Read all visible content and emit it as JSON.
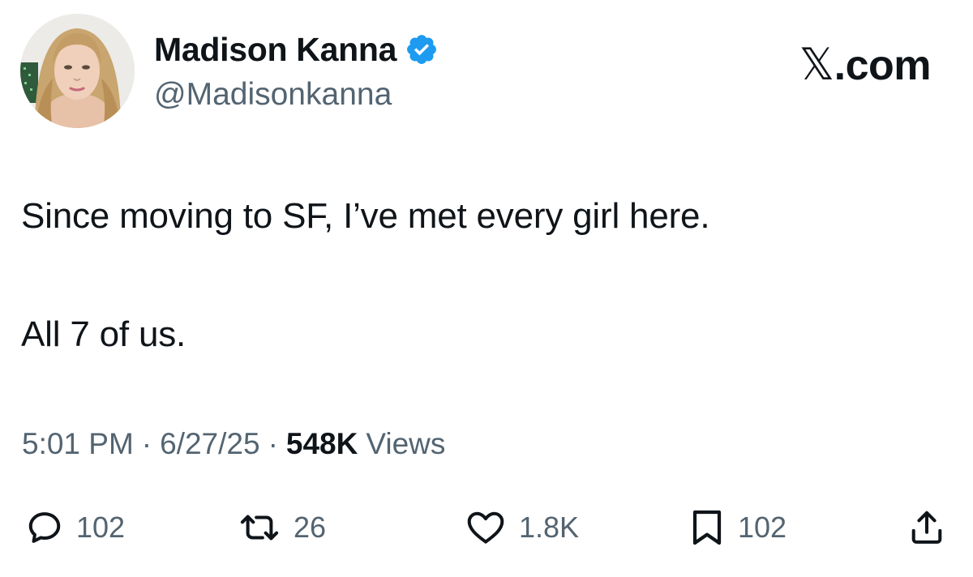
{
  "author": {
    "display_name": "Madison Kanna",
    "handle": "@Madisonkanna",
    "verified": true,
    "verified_color": "#1d9bf0"
  },
  "brand": {
    "label": "com",
    "mark": "𝕏"
  },
  "tweet": {
    "line_1": "Since moving to SF, I’ve met every girl here.",
    "line_2": "All 7 of us."
  },
  "meta": {
    "time": "5:01 PM",
    "separator": "·",
    "date": "6/27/25",
    "views_count": "548K",
    "views_label": "Views"
  },
  "actions": {
    "reply_count": "102",
    "retweet_count": "26",
    "like_count": "1.8K",
    "bookmark_count": "102"
  },
  "icons": {
    "reply": "reply-icon",
    "retweet": "retweet-icon",
    "like": "heart-icon",
    "bookmark": "bookmark-icon",
    "share": "share-icon",
    "verified": "verified-badge-icon"
  },
  "colors": {
    "text_primary": "#0f1419",
    "text_secondary": "#536471",
    "background": "#ffffff"
  }
}
